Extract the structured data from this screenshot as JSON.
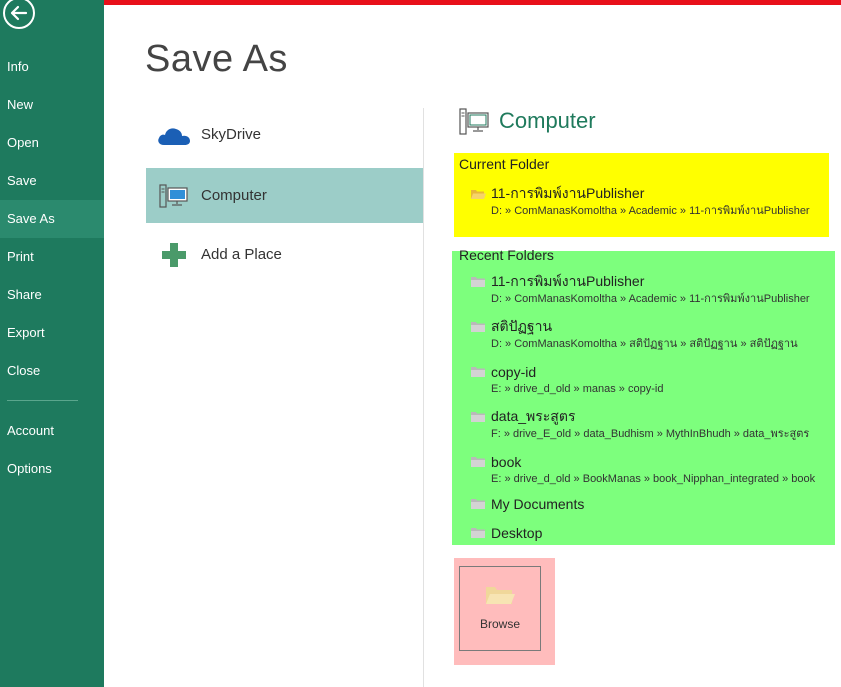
{
  "nav": {
    "items": [
      {
        "label": "Info",
        "name": "nav-item-info"
      },
      {
        "label": "New",
        "name": "nav-item-new"
      },
      {
        "label": "Open",
        "name": "nav-item-open"
      },
      {
        "label": "Save",
        "name": "nav-item-save"
      },
      {
        "label": "Save As",
        "name": "nav-item-save-as",
        "active": true
      },
      {
        "label": "Print",
        "name": "nav-item-print"
      },
      {
        "label": "Share",
        "name": "nav-item-share"
      },
      {
        "label": "Export",
        "name": "nav-item-export"
      },
      {
        "label": "Close",
        "name": "nav-item-close"
      }
    ],
    "bottom_items": [
      {
        "label": "Account",
        "name": "nav-item-account"
      },
      {
        "label": "Options",
        "name": "nav-item-options"
      }
    ]
  },
  "page_title": "Save As",
  "places": [
    {
      "label": "SkyDrive",
      "icon": "cloud-icon"
    },
    {
      "label": "Computer",
      "icon": "computer-icon",
      "selected": true
    },
    {
      "label": "Add a Place",
      "icon": "plus-icon"
    }
  ],
  "right": {
    "title": "Computer",
    "current_folder_label": "Current Folder",
    "current_folder": {
      "name": "11-การพิมพ์งานPublisher",
      "path": "D: » ComManasKomoltha » Academic » 11-การพิมพ์งานPublisher"
    },
    "recent_folders_label": "Recent Folders",
    "recent_folders": [
      {
        "name": "11-การพิมพ์งานPublisher",
        "path": "D: » ComManasKomoltha » Academic » 11-การพิมพ์งานPublisher"
      },
      {
        "name": "สติปัฏฐาน",
        "path": "D: » ComManasKomoltha » สติปัฏฐาน » สติปัฏฐาน » สติปัฏฐาน"
      },
      {
        "name": "copy-id",
        "path": "E: » drive_d_old » manas » copy-id"
      },
      {
        "name": "data_พระสูตร",
        "path": "F: » drive_E_old » data_Budhism » MythInBhudh » data_พระสูตร"
      },
      {
        "name": "book",
        "path": "E: » drive_d_old » BookManas » book_Nipphan_integrated » book"
      },
      {
        "name": "My Documents",
        "path": ""
      },
      {
        "name": "Desktop",
        "path": ""
      }
    ],
    "browse_label": "Browse"
  },
  "colors": {
    "nav_bg": "#1e7a5e",
    "top_bar": "#e8101a",
    "current_highlight": "#ffff00",
    "recent_highlight": "#7dff7d",
    "browse_highlight": "#ffbcbc"
  }
}
